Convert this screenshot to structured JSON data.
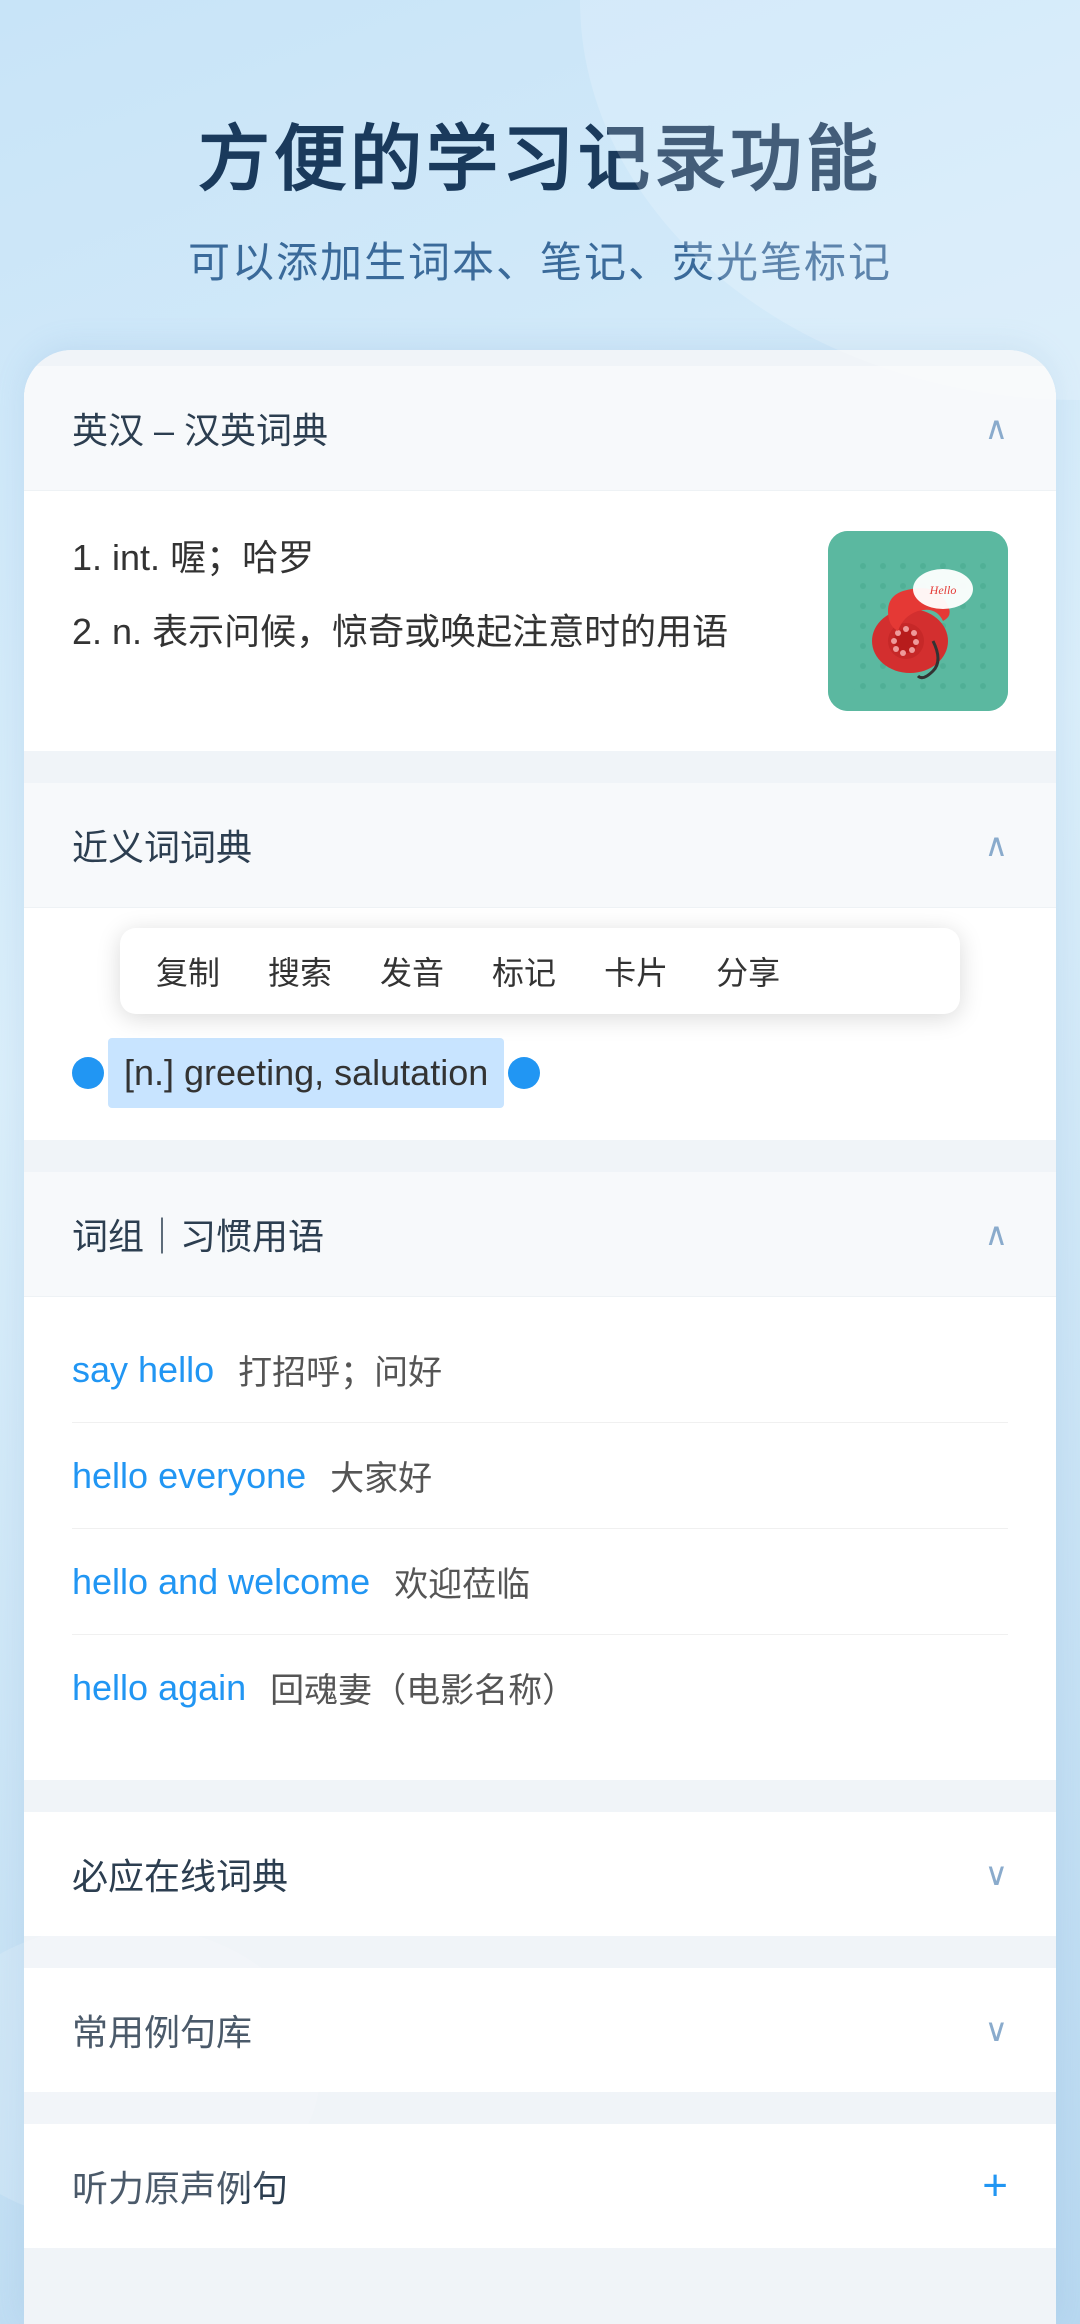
{
  "header": {
    "title": "方便的学习记录功能",
    "subtitle": "可以添加生词本、笔记、荧光笔标记"
  },
  "dict_section": {
    "title": "英汉 – 汉英词典",
    "chevron": "∧",
    "definitions": [
      {
        "num": "1.",
        "part_of_speech": "int.",
        "meaning": "喔；哈罗"
      },
      {
        "num": "2.",
        "part_of_speech": "n.",
        "meaning": "表示问候，惊奇或唤起注意时的用语"
      }
    ],
    "image_alt": "Hello telephone illustration"
  },
  "synonyms_section": {
    "title": "近义词词典",
    "chevron": "∧",
    "context_menu": {
      "items": [
        "复制",
        "搜索",
        "发音",
        "标记",
        "卡片",
        "分享"
      ]
    },
    "selected_text": "[n.] greeting, salutation"
  },
  "phrases_section": {
    "title": "词组｜习惯用语",
    "chevron": "∧",
    "phrases": [
      {
        "english": "say hello",
        "chinese": "打招呼；问好"
      },
      {
        "english": "hello everyone",
        "chinese": "大家好"
      },
      {
        "english": "hello and welcome",
        "chinese": "欢迎莅临"
      },
      {
        "english": "hello again",
        "chinese": "回魂妻（电影名称）"
      }
    ]
  },
  "byying_section": {
    "title": "必应在线词典",
    "chevron": "∨"
  },
  "example_section": {
    "title": "常用例句库",
    "chevron": "∨"
  },
  "listening_section": {
    "title": "听力原声例句",
    "plus": "+"
  },
  "icons": {
    "chevron_up": "∧",
    "chevron_down": "∨",
    "plus": "+"
  }
}
